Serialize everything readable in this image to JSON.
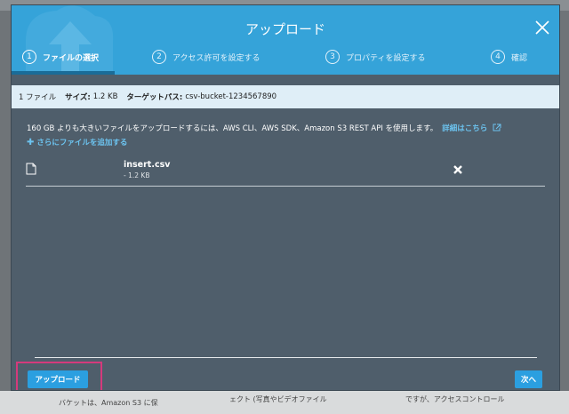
{
  "modal": {
    "title": "アップロード",
    "steps": [
      {
        "num": "1",
        "label": "ファイルの選択"
      },
      {
        "num": "2",
        "label": "アクセス許可を設定する"
      },
      {
        "num": "3",
        "label": "プロパティを設定する"
      },
      {
        "num": "4",
        "label": "確認"
      }
    ]
  },
  "info_bar": {
    "file_count": "1 ファイル",
    "size_label": "サイズ:",
    "size_value": "1.2 KB",
    "target_label": "ターゲットパス:",
    "target_value": "csv-bucket-1234567890"
  },
  "notice": {
    "text": "160 GB よりも大きいファイルをアップロードするには、AWS CLI、AWS SDK、Amazon S3 REST API を使用します。",
    "link": "詳細はこちら"
  },
  "add_more": "さらにファイルを追加する",
  "files": [
    {
      "name": "insert.csv",
      "size": "- 1.2 KB"
    }
  ],
  "footer": {
    "upload_label": "アップロード",
    "next_label": "次へ"
  },
  "background": {
    "col1": "バケットは、Amazon S3 に保",
    "col2": "ェクト (写真やビデオファイル",
    "col3": "ですが、アクセスコントロール"
  },
  "colors": {
    "header": "#35a3d9",
    "modal_body": "#4f5e6b",
    "button": "#2b9fe0",
    "link": "#6cc3ef",
    "highlight": "#d43a7c"
  }
}
